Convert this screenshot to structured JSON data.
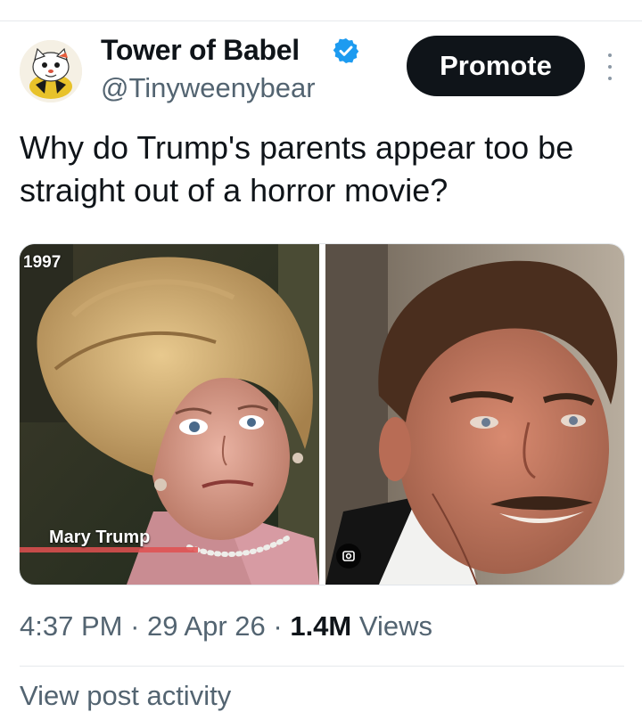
{
  "post": {
    "author_name": "Tower of Babel",
    "handle": "@Tinyweenybear",
    "promote_label": "Promote",
    "text": "Why do Trump's parents appear too be straight out of a horror movie?"
  },
  "media": {
    "left_photo": {
      "year_caption": "1997",
      "name_caption": "Mary Trump"
    },
    "right_photo": {}
  },
  "meta": {
    "time": "4:37 PM",
    "separator": "·",
    "date": "29 Apr 26",
    "views_count": "1.4M",
    "views_label": "Views"
  },
  "next_row": {
    "text": "View post activity"
  },
  "colors": {
    "verified_badge": "#1d9bf0",
    "promote_bg": "#0f1419",
    "secondary_text": "#536471",
    "divider": "#e6e9ec"
  },
  "icons": {
    "verified": "verified-badge-icon",
    "more": "more-dots-icon",
    "lens": "lens-icon"
  }
}
